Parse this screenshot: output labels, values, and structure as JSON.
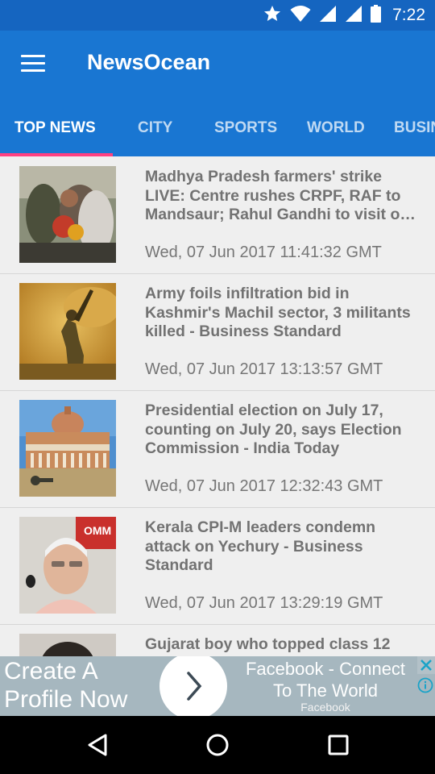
{
  "status_bar": {
    "time": "7:22",
    "icons": [
      "star-icon",
      "wifi-icon",
      "signal-icon",
      "signal-icon",
      "battery-icon"
    ]
  },
  "app_bar": {
    "title": "NewsOcean",
    "menu_icon": "hamburger-menu-icon",
    "tabs": [
      {
        "label": "TOP NEWS",
        "active": true
      },
      {
        "label": "CITY",
        "active": false
      },
      {
        "label": "SPORTS",
        "active": false
      },
      {
        "label": "WORLD",
        "active": false
      },
      {
        "label": "BUSINESS",
        "active": false
      }
    ],
    "accent": "#ff4081",
    "primary": "#1976d2",
    "primary_dark": "#1565c0"
  },
  "feed": {
    "items": [
      {
        "headline": "Madhya Pradesh farmers' strike LIVE: Centre rushes CRPF, RAF to Mandsaur; Rahul Gandhi to visit o…",
        "date": "Wed, 07 Jun 2017 11:41:32 GMT"
      },
      {
        "headline": "Army foils infiltration bid in Kashmir's Machil sector, 3 militants killed - Business Standard",
        "date": "Wed, 07 Jun 2017 13:13:57 GMT"
      },
      {
        "headline": "Presidential election on July 17, counting on July 20, says Election Commission - India Today",
        "date": "Wed, 07 Jun 2017 12:32:43 GMT"
      },
      {
        "headline": "Kerala CPI-M leaders condemn attack on Yechury - Business Standard",
        "date": "Wed, 07 Jun 2017 13:29:19 GMT"
      },
      {
        "headline": "Gujarat boy who topped class 12",
        "date": ""
      }
    ]
  },
  "ad": {
    "left_line1": "Create A",
    "left_line2": "Profile Now",
    "right_line1": "Facebook - Connect",
    "right_line2": "To The World",
    "sponsor": "Facebook"
  },
  "nav_bar": {
    "buttons": [
      "back-icon",
      "home-icon",
      "recents-icon"
    ]
  }
}
